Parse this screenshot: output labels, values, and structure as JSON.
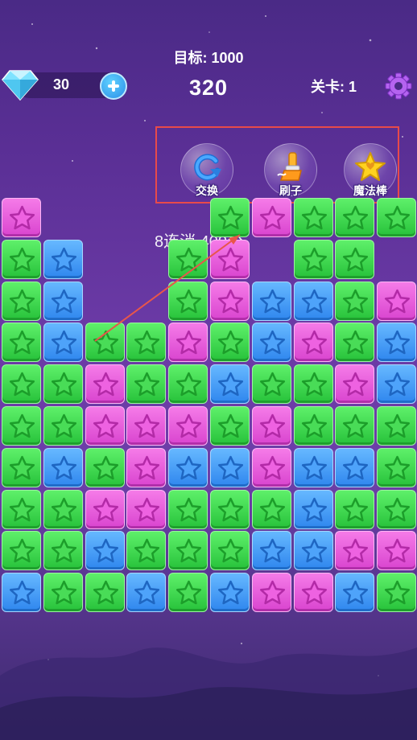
{
  "hud": {
    "target_label": "目标:",
    "target_value": "1000",
    "score": "320",
    "gems": "30",
    "level_label": "关卡:",
    "level_value": "1"
  },
  "tools": [
    {
      "label": "交换",
      "icon": "swap-icon"
    },
    {
      "label": "刷子",
      "icon": "brush-icon"
    },
    {
      "label": "魔法棒",
      "icon": "magic-wand-icon"
    }
  ],
  "combo_text": "8连消 400分",
  "colors": {
    "green": "#3fd34e",
    "blue": "#3d92f2",
    "pink": "#e656da",
    "highlight": "#e84a4a"
  },
  "board": {
    "columns": 10,
    "rows": [
      "P.........",
      "GB..GP.GG.",
      "GB..GPBBGP",
      "GBGGPGBPGB",
      "GGPGGBGGPB",
      "GGPPPGPGGG",
      "GBGPBBPBBG",
      "GGPPGGGBGG",
      "GGBGGGBBPP",
      "BGGBGBPPBG"
    ],
    "floating_tiles": [
      "P",
      "G",
      "G"
    ],
    "top_row_extra": [
      "G",
      "P",
      "G",
      "G",
      "G"
    ]
  }
}
